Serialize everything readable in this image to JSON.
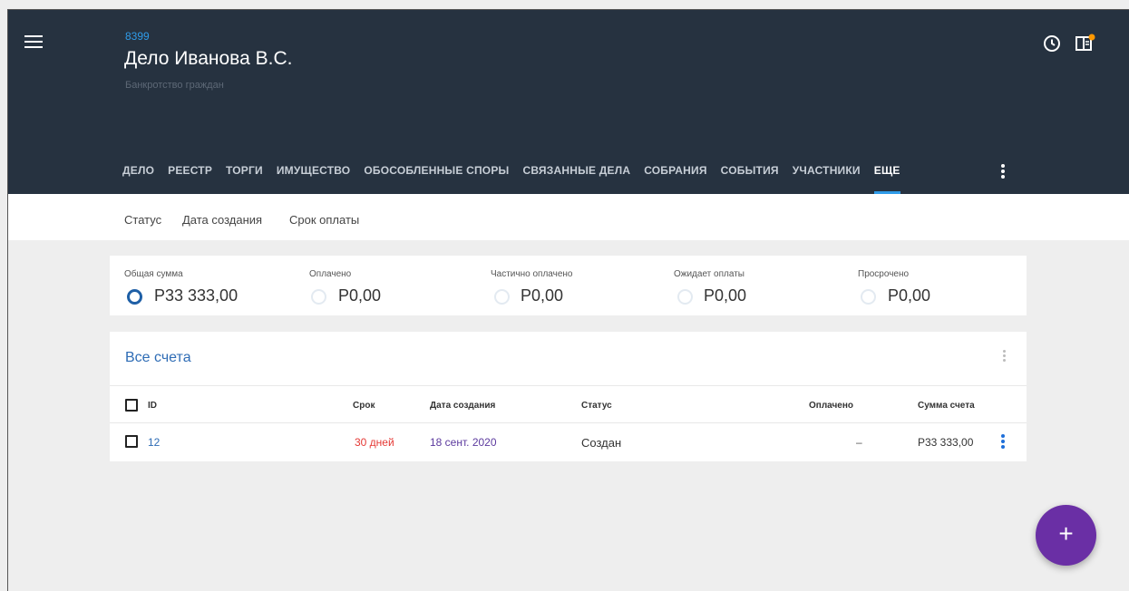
{
  "header": {
    "case_id": "8399",
    "title": "Дело Иванова В.С.",
    "subtitle": "Банкротство граждан"
  },
  "tabs": [
    {
      "label": "ДЕЛО"
    },
    {
      "label": "РЕЕСТР"
    },
    {
      "label": "ТОРГИ"
    },
    {
      "label": "ИМУЩЕСТВО"
    },
    {
      "label": "ОБОСОБЛЕННЫЕ СПОРЫ"
    },
    {
      "label": "СВЯЗАННЫЕ ДЕЛА"
    },
    {
      "label": "СОБРАНИЯ"
    },
    {
      "label": "СОБЫТИЯ"
    },
    {
      "label": "УЧАСТНИКИ"
    },
    {
      "label": "ЕЩЕ"
    }
  ],
  "active_tab": "ЕЩЕ",
  "subnav": {
    "status": "Статус",
    "created": "Дата создания",
    "payment_term": "Срок оплаты"
  },
  "summary": {
    "total_label": "Общая сумма",
    "total_value": "Р33 333,00",
    "paid_label": "Оплачено",
    "paid_value": "Р0,00",
    "partial_label": "Частично оплачено",
    "partial_value": "Р0,00",
    "pending_label": "Ожидает оплаты",
    "pending_value": "Р0,00",
    "overdue_label": "Просрочено",
    "overdue_value": "Р0,00"
  },
  "invoices": {
    "title": "Все счета",
    "columns": {
      "id": "ID",
      "term": "Срок",
      "created": "Дата создания",
      "status": "Статус",
      "paid": "Оплачено",
      "amount": "Сумма счета"
    },
    "rows": [
      {
        "id": "12",
        "term": "30 дней",
        "created": "18 сент. 2020",
        "status": "Создан",
        "paid": "–",
        "amount": "Р33 333,00"
      }
    ]
  },
  "fab": {
    "label": "+"
  },
  "icons": {
    "menu": "menu-icon",
    "history": "clock-icon",
    "panel": "panel-notification-icon",
    "more": "more-vertical-icon",
    "add": "plus-icon"
  },
  "colors": {
    "header_bg": "#263240",
    "accent_blue": "#2f9be8",
    "link_blue": "#2e6cb5",
    "term_red": "#e53935",
    "date_purple": "#5c3a9e",
    "fab_purple": "#6a2fa5",
    "notification_orange": "#ff9800"
  }
}
